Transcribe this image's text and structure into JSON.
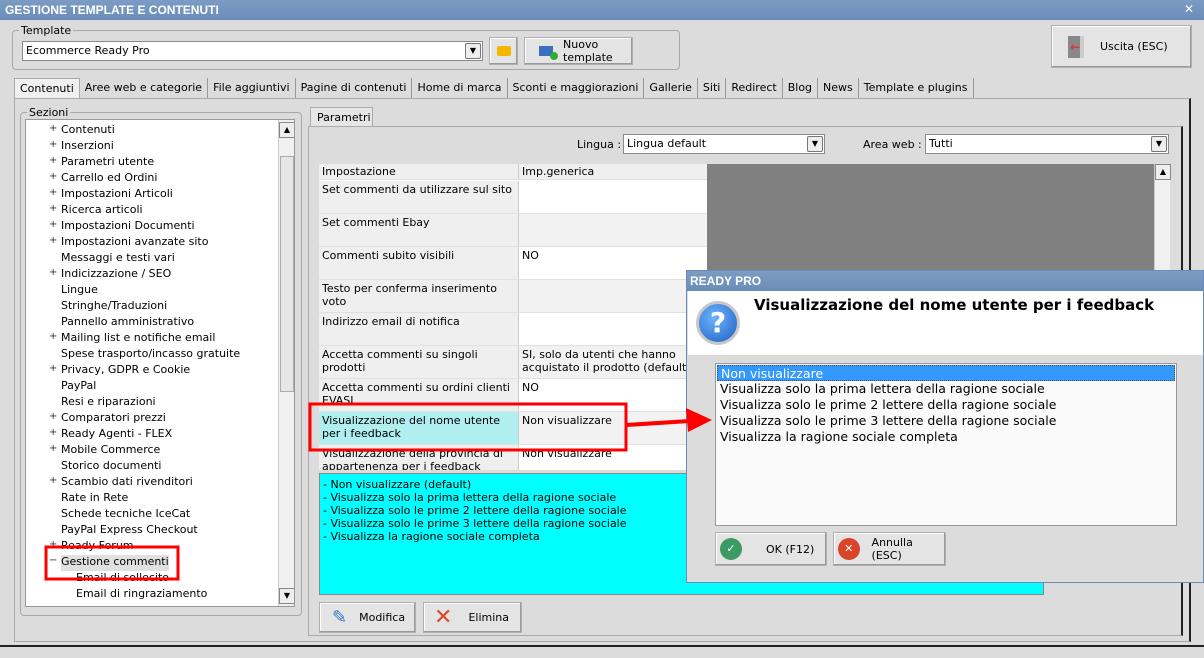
{
  "window": {
    "title": "GESTIONE TEMPLATE E CONTENUTI",
    "close": "✕"
  },
  "template": {
    "legend": "Template",
    "value": "Ecommerce Ready Pro",
    "new_button": "Nuovo template"
  },
  "exit_button": "Uscita (ESC)",
  "tabs": [
    "Contenuti",
    "Aree web e categorie",
    "File aggiuntivi",
    "Pagine di contenuti",
    "Home di marca",
    "Sconti e maggiorazioni",
    "Gallerie",
    "Siti",
    "Redirect",
    "Blog",
    "News",
    "Template e plugins"
  ],
  "sections": {
    "legend": "Sezioni",
    "items": [
      {
        "label": "Contenuti",
        "exp": "+",
        "lvl": 0
      },
      {
        "label": "Inserzioni",
        "exp": "+",
        "lvl": 0
      },
      {
        "label": "Parametri utente",
        "exp": "+",
        "lvl": 0
      },
      {
        "label": "Carrello ed Ordini",
        "exp": "+",
        "lvl": 0
      },
      {
        "label": "Impostazioni Articoli",
        "exp": "+",
        "lvl": 0
      },
      {
        "label": "Ricerca articoli",
        "exp": "+",
        "lvl": 0
      },
      {
        "label": "Impostazioni Documenti",
        "exp": "+",
        "lvl": 0
      },
      {
        "label": "Impostazioni avanzate sito",
        "exp": "+",
        "lvl": 0
      },
      {
        "label": "Messaggi e testi vari",
        "exp": "",
        "lvl": 0
      },
      {
        "label": "Indicizzazione / SEO",
        "exp": "+",
        "lvl": 0
      },
      {
        "label": "Lingue",
        "exp": "",
        "lvl": 0
      },
      {
        "label": "Stringhe/Traduzioni",
        "exp": "",
        "lvl": 0
      },
      {
        "label": "Pannello amministrativo",
        "exp": "",
        "lvl": 0
      },
      {
        "label": "Mailing list e notifiche email",
        "exp": "+",
        "lvl": 0
      },
      {
        "label": "Spese trasporto/incasso gratuite",
        "exp": "",
        "lvl": 0
      },
      {
        "label": "Privacy, GDPR e Cookie",
        "exp": "+",
        "lvl": 0
      },
      {
        "label": "PayPal",
        "exp": "",
        "lvl": 0
      },
      {
        "label": "Resi e riparazioni",
        "exp": "",
        "lvl": 0
      },
      {
        "label": "Comparatori prezzi",
        "exp": "+",
        "lvl": 0
      },
      {
        "label": "Ready Agenti - FLEX",
        "exp": "+",
        "lvl": 0
      },
      {
        "label": "Mobile Commerce",
        "exp": "+",
        "lvl": 0
      },
      {
        "label": "Storico documenti",
        "exp": "",
        "lvl": 0
      },
      {
        "label": "Scambio dati rivenditori",
        "exp": "+",
        "lvl": 0
      },
      {
        "label": "Rate in Rete",
        "exp": "",
        "lvl": 0
      },
      {
        "label": "Schede tecniche IceCat",
        "exp": "",
        "lvl": 0
      },
      {
        "label": "PayPal Express Checkout",
        "exp": "",
        "lvl": 0
      },
      {
        "label": "Ready Forum",
        "exp": "+",
        "lvl": 0
      },
      {
        "label": "Gestione commenti",
        "exp": "−",
        "lvl": 0,
        "selected": true
      },
      {
        "label": "Email di sollecito",
        "exp": "",
        "lvl": 1
      },
      {
        "label": "Email di ringraziamento",
        "exp": "",
        "lvl": 1
      }
    ]
  },
  "params": {
    "tab": "Parametri",
    "lingua_label": "Lingua :",
    "lingua_value": "Lingua default",
    "area_label": "Area web :",
    "area_value": "Tutti",
    "columns": [
      "Impostazione",
      "Imp.generica"
    ],
    "rows": [
      {
        "name": "Set commenti da utilizzare sul sito",
        "value": ""
      },
      {
        "name": "Set commenti Ebay",
        "value": ""
      },
      {
        "name": "Commenti subito visibili",
        "value": "NO"
      },
      {
        "name": "Testo per conferma inserimento voto",
        "value": ""
      },
      {
        "name": "Indirizzo email di notifica",
        "value": ""
      },
      {
        "name": "Accetta commenti su singoli prodotti",
        "value": "SI, solo da utenti che hanno acquistato il prodotto (default)"
      },
      {
        "name": "Accetta commenti su ordini clienti EVASI",
        "value": "NO"
      },
      {
        "name": "Visualizzazione del nome utente per i feedback",
        "value": "Non visualizzare",
        "selected": true
      },
      {
        "name": "Visualizzazione della provincia di appartenenza per i feedback",
        "value": "Non visualizzare"
      }
    ],
    "description": [
      "- Non visualizzare (default)",
      "- Visualizza solo la prima lettera della ragione sociale",
      "- Visualizza solo le prime 2 lettere della ragione sociale",
      "- Visualizza solo le prime 3 lettere della ragione sociale",
      "- Visualizza la ragione sociale completa"
    ],
    "edit_button": "Modifica",
    "delete_button": "Elimina"
  },
  "dialog": {
    "title": "READY PRO",
    "question": "Visualizzazione del nome utente per i feedback",
    "options": [
      "Non visualizzare",
      "Visualizza solo la prima lettera della ragione sociale",
      "Visualizza solo le prime 2 lettere della ragione sociale",
      "Visualizza solo le prime 3 lettere della ragione sociale",
      "Visualizza la ragione sociale completa"
    ],
    "selected_index": 0,
    "ok": "OK (F12)",
    "cancel": "Annulla (ESC)"
  },
  "colors": {
    "titlebar": "#6a8db8",
    "selection": "#3399ff",
    "description_bg": "#00ffff",
    "highlight": "#ff0000",
    "selected_row": "#b0eef0"
  }
}
